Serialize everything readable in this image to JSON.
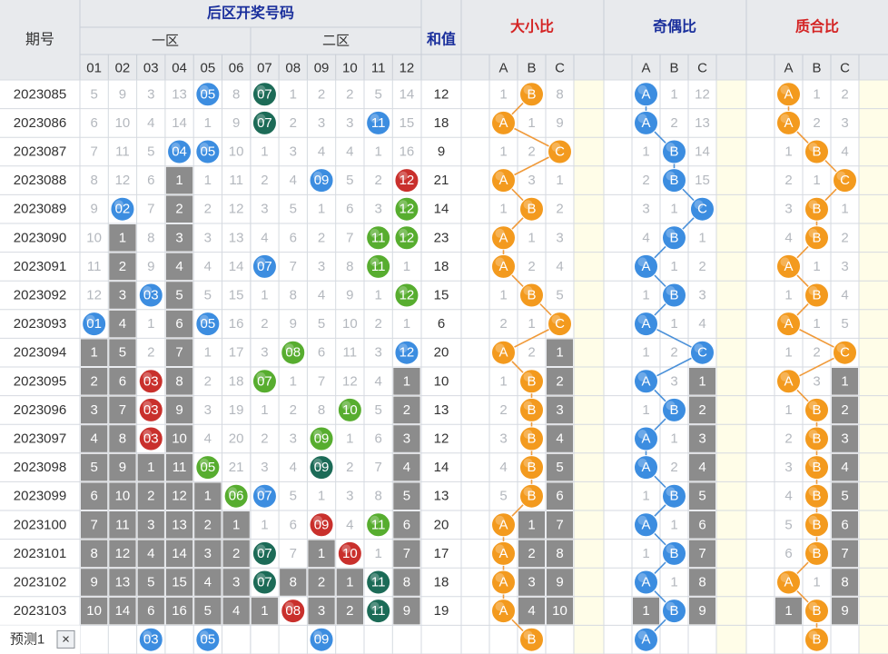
{
  "header": {
    "period": "期号",
    "zone_title": "后区开奖号码",
    "zone1": "一区",
    "zone2": "二区",
    "sum": "和值",
    "size_ratio": "大小比",
    "odd_even_ratio": "奇偶比",
    "prime_ratio": "质合比",
    "numbers": [
      "01",
      "02",
      "03",
      "04",
      "05",
      "06",
      "07",
      "08",
      "09",
      "10",
      "11",
      "12"
    ],
    "abc": [
      "A",
      "B",
      "C"
    ]
  },
  "colors": {
    "blue_ball": "#3c8de0",
    "dteal_ball": "#1c6b57",
    "green_ball": "#57ad2f",
    "red_ball": "#c9302c",
    "orange_ball": "#f39a1e",
    "gray_cell": "#8c8c8c",
    "cream_col": "#fffde8",
    "line_blue": "#4a90d9",
    "line_orange": "#f09a3a"
  },
  "rows": [
    {
      "p": "2023085",
      "n": [
        [
          "5"
        ],
        [
          "9"
        ],
        [
          "3"
        ],
        [
          "13"
        ],
        [
          "05",
          "b"
        ],
        [
          "8"
        ],
        [
          "07",
          "d"
        ],
        [
          "1"
        ],
        [
          "2"
        ],
        [
          "2"
        ],
        [
          "5"
        ],
        [
          "14"
        ]
      ],
      "sum": "12",
      "s": [
        "1",
        "B",
        "8"
      ],
      "o": [
        "A",
        "1",
        "12"
      ],
      "q": [
        "A",
        "1",
        "2"
      ]
    },
    {
      "p": "2023086",
      "n": [
        [
          "6"
        ],
        [
          "10"
        ],
        [
          "4"
        ],
        [
          "14"
        ],
        [
          "1"
        ],
        [
          "9"
        ],
        [
          "07",
          "d"
        ],
        [
          "2"
        ],
        [
          "3"
        ],
        [
          "3"
        ],
        [
          "11",
          "b"
        ],
        [
          "15"
        ]
      ],
      "sum": "18",
      "s": [
        "A",
        "1",
        "9"
      ],
      "o": [
        "A",
        "2",
        "13"
      ],
      "q": [
        "A",
        "2",
        "3"
      ]
    },
    {
      "p": "2023087",
      "n": [
        [
          "7"
        ],
        [
          "11"
        ],
        [
          "5"
        ],
        [
          "04",
          "b"
        ],
        [
          "05",
          "b"
        ],
        [
          "10"
        ],
        [
          "1"
        ],
        [
          "3"
        ],
        [
          "4"
        ],
        [
          "4"
        ],
        [
          "1"
        ],
        [
          "16"
        ]
      ],
      "sum": "9",
      "s": [
        "1",
        "2",
        "C"
      ],
      "o": [
        "1",
        "B",
        "14"
      ],
      "q": [
        "1",
        "B",
        "4"
      ]
    },
    {
      "p": "2023088",
      "n": [
        [
          "8"
        ],
        [
          "12"
        ],
        [
          "6"
        ],
        [
          "1",
          "g"
        ],
        [
          "1"
        ],
        [
          "11"
        ],
        [
          "2"
        ],
        [
          "4"
        ],
        [
          "09",
          "b"
        ],
        [
          "5"
        ],
        [
          "2"
        ],
        [
          "12",
          "r"
        ]
      ],
      "sum": "21",
      "s": [
        "A",
        "3",
        "1"
      ],
      "o": [
        "2",
        "B",
        "15"
      ],
      "q": [
        "2",
        "1",
        "C"
      ]
    },
    {
      "p": "2023089",
      "n": [
        [
          "9"
        ],
        [
          "02",
          "b"
        ],
        [
          "7"
        ],
        [
          "2",
          "g"
        ],
        [
          "2"
        ],
        [
          "12"
        ],
        [
          "3"
        ],
        [
          "5"
        ],
        [
          "1"
        ],
        [
          "6"
        ],
        [
          "3"
        ],
        [
          "12",
          "n"
        ]
      ],
      "sum": "14",
      "s": [
        "1",
        "B",
        "2"
      ],
      "o": [
        "3",
        "1",
        "C"
      ],
      "q": [
        "3",
        "B",
        "1"
      ]
    },
    {
      "p": "2023090",
      "n": [
        [
          "10"
        ],
        [
          "1",
          "g"
        ],
        [
          "8"
        ],
        [
          "3",
          "g"
        ],
        [
          "3"
        ],
        [
          "13"
        ],
        [
          "4"
        ],
        [
          "6"
        ],
        [
          "2"
        ],
        [
          "7"
        ],
        [
          "11",
          "n"
        ],
        [
          "12",
          "n"
        ]
      ],
      "sum": "23",
      "s": [
        "A",
        "1",
        "3"
      ],
      "o": [
        "4",
        "B",
        "1"
      ],
      "q": [
        "4",
        "B",
        "2"
      ]
    },
    {
      "p": "2023091",
      "n": [
        [
          "11"
        ],
        [
          "2",
          "g"
        ],
        [
          "9"
        ],
        [
          "4",
          "g"
        ],
        [
          "4"
        ],
        [
          "14"
        ],
        [
          "07",
          "b"
        ],
        [
          "7"
        ],
        [
          "3"
        ],
        [
          "8"
        ],
        [
          "11",
          "n"
        ],
        [
          "1"
        ]
      ],
      "sum": "18",
      "s": [
        "A",
        "2",
        "4"
      ],
      "o": [
        "A",
        "1",
        "2"
      ],
      "q": [
        "A",
        "1",
        "3"
      ]
    },
    {
      "p": "2023092",
      "n": [
        [
          "12"
        ],
        [
          "3",
          "g"
        ],
        [
          "03",
          "b"
        ],
        [
          "5",
          "g"
        ],
        [
          "5"
        ],
        [
          "15"
        ],
        [
          "1"
        ],
        [
          "8"
        ],
        [
          "4"
        ],
        [
          "9"
        ],
        [
          "1"
        ],
        [
          "12",
          "n"
        ]
      ],
      "sum": "15",
      "s": [
        "1",
        "B",
        "5"
      ],
      "o": [
        "1",
        "B",
        "3"
      ],
      "q": [
        "1",
        "B",
        "4"
      ]
    },
    {
      "p": "2023093",
      "n": [
        [
          "01",
          "b"
        ],
        [
          "4",
          "g"
        ],
        [
          "1"
        ],
        [
          "6",
          "g"
        ],
        [
          "05",
          "b"
        ],
        [
          "16"
        ],
        [
          "2"
        ],
        [
          "9"
        ],
        [
          "5"
        ],
        [
          "10"
        ],
        [
          "2"
        ],
        [
          "1"
        ]
      ],
      "sum": "6",
      "s": [
        "2",
        "1",
        "C"
      ],
      "o": [
        "A",
        "1",
        "4"
      ],
      "q": [
        "A",
        "1",
        "5"
      ]
    },
    {
      "p": "2023094",
      "n": [
        [
          "1",
          "g"
        ],
        [
          "5",
          "g"
        ],
        [
          "2"
        ],
        [
          "7",
          "g"
        ],
        [
          "1"
        ],
        [
          "17"
        ],
        [
          "3"
        ],
        [
          "08",
          "n"
        ],
        [
          "6"
        ],
        [
          "11"
        ],
        [
          "3"
        ],
        [
          "12",
          "b"
        ]
      ],
      "sum": "20",
      "s": [
        "A",
        "2",
        "1g"
      ],
      "o": [
        "1",
        "2",
        "C"
      ],
      "q": [
        "1",
        "2",
        "C"
      ]
    },
    {
      "p": "2023095",
      "n": [
        [
          "2",
          "g"
        ],
        [
          "6",
          "g"
        ],
        [
          "03",
          "r"
        ],
        [
          "8",
          "g"
        ],
        [
          "2"
        ],
        [
          "18"
        ],
        [
          "07",
          "n"
        ],
        [
          "1"
        ],
        [
          "7"
        ],
        [
          "12"
        ],
        [
          "4"
        ],
        [
          "1",
          "g"
        ]
      ],
      "sum": "10",
      "s": [
        "1",
        "B",
        "2g"
      ],
      "o": [
        "A",
        "3",
        "1g"
      ],
      "q": [
        "A",
        "3",
        "1g"
      ]
    },
    {
      "p": "2023096",
      "n": [
        [
          "3",
          "g"
        ],
        [
          "7",
          "g"
        ],
        [
          "03",
          "r"
        ],
        [
          "9",
          "g"
        ],
        [
          "3"
        ],
        [
          "19"
        ],
        [
          "1"
        ],
        [
          "2"
        ],
        [
          "8"
        ],
        [
          "10",
          "n"
        ],
        [
          "5"
        ],
        [
          "2",
          "g"
        ]
      ],
      "sum": "13",
      "s": [
        "2",
        "B",
        "3g"
      ],
      "o": [
        "1",
        "B",
        "2g"
      ],
      "q": [
        "1",
        "B",
        "2g"
      ]
    },
    {
      "p": "2023097",
      "n": [
        [
          "4",
          "g"
        ],
        [
          "8",
          "g"
        ],
        [
          "03",
          "r"
        ],
        [
          "10",
          "g"
        ],
        [
          "4"
        ],
        [
          "20"
        ],
        [
          "2"
        ],
        [
          "3"
        ],
        [
          "09",
          "n"
        ],
        [
          "1"
        ],
        [
          "6"
        ],
        [
          "3",
          "g"
        ]
      ],
      "sum": "12",
      "s": [
        "3",
        "B",
        "4g"
      ],
      "o": [
        "A",
        "1",
        "3g"
      ],
      "q": [
        "2",
        "B",
        "3g"
      ]
    },
    {
      "p": "2023098",
      "n": [
        [
          "5",
          "g"
        ],
        [
          "9",
          "g"
        ],
        [
          "1",
          "g"
        ],
        [
          "11",
          "g"
        ],
        [
          "05",
          "n"
        ],
        [
          "21"
        ],
        [
          "3"
        ],
        [
          "4"
        ],
        [
          "09",
          "d"
        ],
        [
          "2"
        ],
        [
          "7"
        ],
        [
          "4",
          "g"
        ]
      ],
      "sum": "14",
      "s": [
        "4",
        "B",
        "5g"
      ],
      "o": [
        "A",
        "2",
        "4g"
      ],
      "q": [
        "3",
        "B",
        "4g"
      ]
    },
    {
      "p": "2023099",
      "n": [
        [
          "6",
          "g"
        ],
        [
          "10",
          "g"
        ],
        [
          "2",
          "g"
        ],
        [
          "12",
          "g"
        ],
        [
          "1",
          "g"
        ],
        [
          "06",
          "n"
        ],
        [
          "07",
          "b"
        ],
        [
          "5"
        ],
        [
          "1"
        ],
        [
          "3"
        ],
        [
          "8"
        ],
        [
          "5",
          "g"
        ]
      ],
      "sum": "13",
      "s": [
        "5",
        "B",
        "6g"
      ],
      "o": [
        "1",
        "B",
        "5g"
      ],
      "q": [
        "4",
        "B",
        "5g"
      ]
    },
    {
      "p": "2023100",
      "n": [
        [
          "7",
          "g"
        ],
        [
          "11",
          "g"
        ],
        [
          "3",
          "g"
        ],
        [
          "13",
          "g"
        ],
        [
          "2",
          "g"
        ],
        [
          "1",
          "g"
        ],
        [
          "1"
        ],
        [
          "6"
        ],
        [
          "09",
          "r"
        ],
        [
          "4"
        ],
        [
          "11",
          "n"
        ],
        [
          "6",
          "g"
        ]
      ],
      "sum": "20",
      "s": [
        "A",
        "1g",
        "7g"
      ],
      "o": [
        "A",
        "1",
        "6g"
      ],
      "q": [
        "5",
        "B",
        "6g"
      ]
    },
    {
      "p": "2023101",
      "n": [
        [
          "8",
          "g"
        ],
        [
          "12",
          "g"
        ],
        [
          "4",
          "g"
        ],
        [
          "14",
          "g"
        ],
        [
          "3",
          "g"
        ],
        [
          "2",
          "g"
        ],
        [
          "07",
          "d"
        ],
        [
          "7"
        ],
        [
          "1",
          "g"
        ],
        [
          "10",
          "r"
        ],
        [
          "1"
        ],
        [
          "7",
          "g"
        ]
      ],
      "sum": "17",
      "s": [
        "A",
        "2g",
        "8g"
      ],
      "o": [
        "1",
        "B",
        "7g"
      ],
      "q": [
        "6",
        "B",
        "7g"
      ]
    },
    {
      "p": "2023102",
      "n": [
        [
          "9",
          "g"
        ],
        [
          "13",
          "g"
        ],
        [
          "5",
          "g"
        ],
        [
          "15",
          "g"
        ],
        [
          "4",
          "g"
        ],
        [
          "3",
          "g"
        ],
        [
          "07",
          "d"
        ],
        [
          "8",
          "g"
        ],
        [
          "2",
          "g"
        ],
        [
          "1",
          "g"
        ],
        [
          "11",
          "d"
        ],
        [
          "8",
          "g"
        ]
      ],
      "sum": "18",
      "s": [
        "A",
        "3g",
        "9g"
      ],
      "o": [
        "A",
        "1",
        "8g"
      ],
      "q": [
        "A",
        "1",
        "8g"
      ]
    },
    {
      "p": "2023103",
      "n": [
        [
          "10",
          "g"
        ],
        [
          "14",
          "g"
        ],
        [
          "6",
          "g"
        ],
        [
          "16",
          "g"
        ],
        [
          "5",
          "g"
        ],
        [
          "4",
          "g"
        ],
        [
          "1",
          "g"
        ],
        [
          "08",
          "r"
        ],
        [
          "3",
          "g"
        ],
        [
          "2",
          "g"
        ],
        [
          "11",
          "d"
        ],
        [
          "9",
          "g"
        ]
      ],
      "sum": "19",
      "s": [
        "A",
        "4g",
        "10g"
      ],
      "o": [
        "1g",
        "B",
        "9g"
      ],
      "q": [
        "1g",
        "B",
        "9g"
      ]
    }
  ],
  "predict": {
    "label": "预测1",
    "close": "×",
    "balls": [
      [
        "03",
        3
      ],
      [
        "05",
        5
      ],
      [
        "09",
        9
      ]
    ],
    "size": "B",
    "odd": "A",
    "prime": "B"
  }
}
